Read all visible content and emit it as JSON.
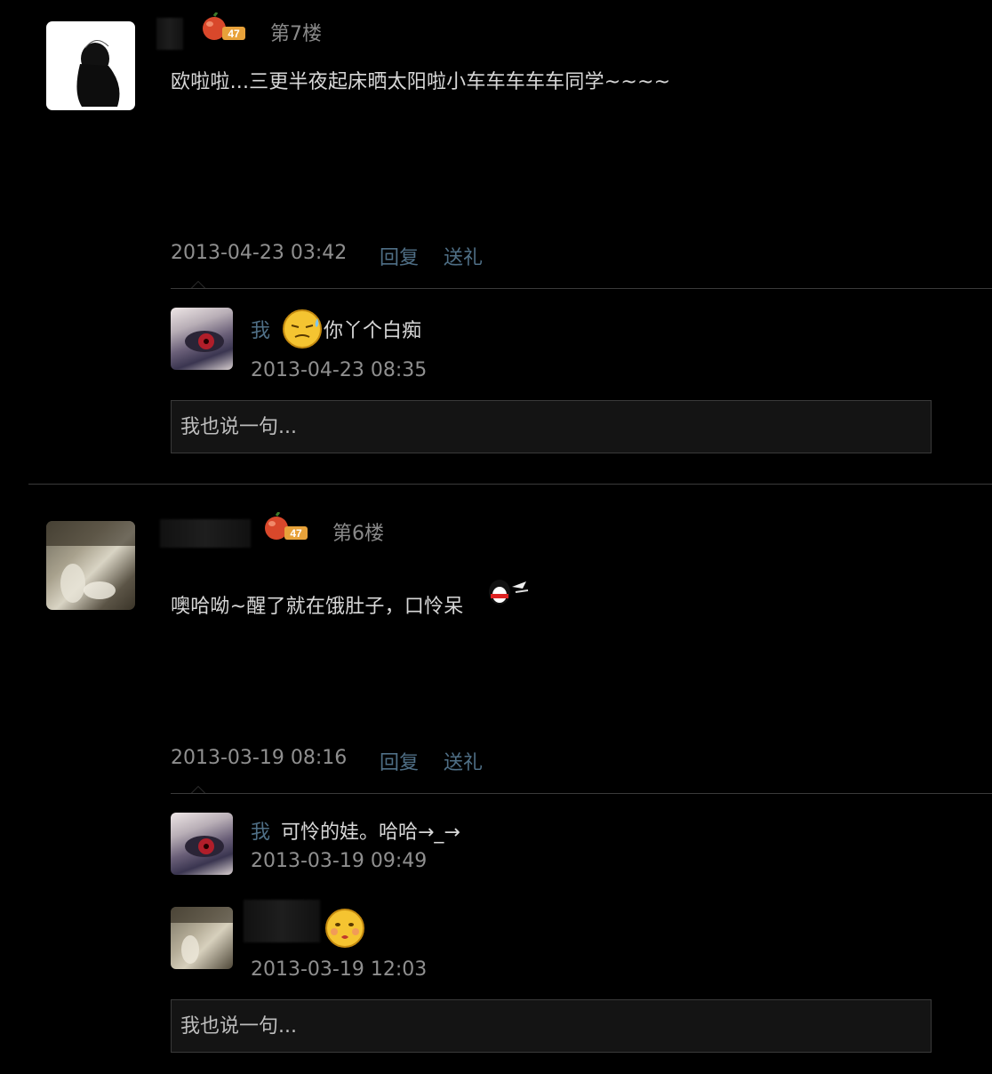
{
  "posts": [
    {
      "floor": "第7楼",
      "badge_number": "47",
      "content": "欧啦啦...三更半夜起床晒太阳啦小车车车车车同学~~~~",
      "time": "2013-04-23 03:42",
      "reply_link": "回复",
      "gift_link": "送礼",
      "replies": [
        {
          "name": "我",
          "text": "你丫个白痴",
          "time": "2013-04-23 08:35",
          "emoji": "cold-sweat-face-icon"
        }
      ],
      "reply_placeholder": "我也说一句..."
    },
    {
      "floor": "第6楼",
      "badge_number": "47",
      "content": "噢哈呦~醒了就在饿肚子，口怜呆",
      "time": "2013-03-19 08:16",
      "reply_link": "回复",
      "gift_link": "送礼",
      "replies": [
        {
          "name": "我",
          "text": "可怜的娃。哈哈→_→",
          "time": "2013-03-19 09:49"
        },
        {
          "name": "",
          "text": "",
          "time": "2013-03-19 12:03",
          "emoji": "pouting-face-icon"
        }
      ],
      "reply_placeholder": "我也说一句..."
    }
  ],
  "colors": {
    "background": "#000000",
    "link": "#4f6f86",
    "meta": "#8f8f8f",
    "divider": "#3a3a3a"
  }
}
